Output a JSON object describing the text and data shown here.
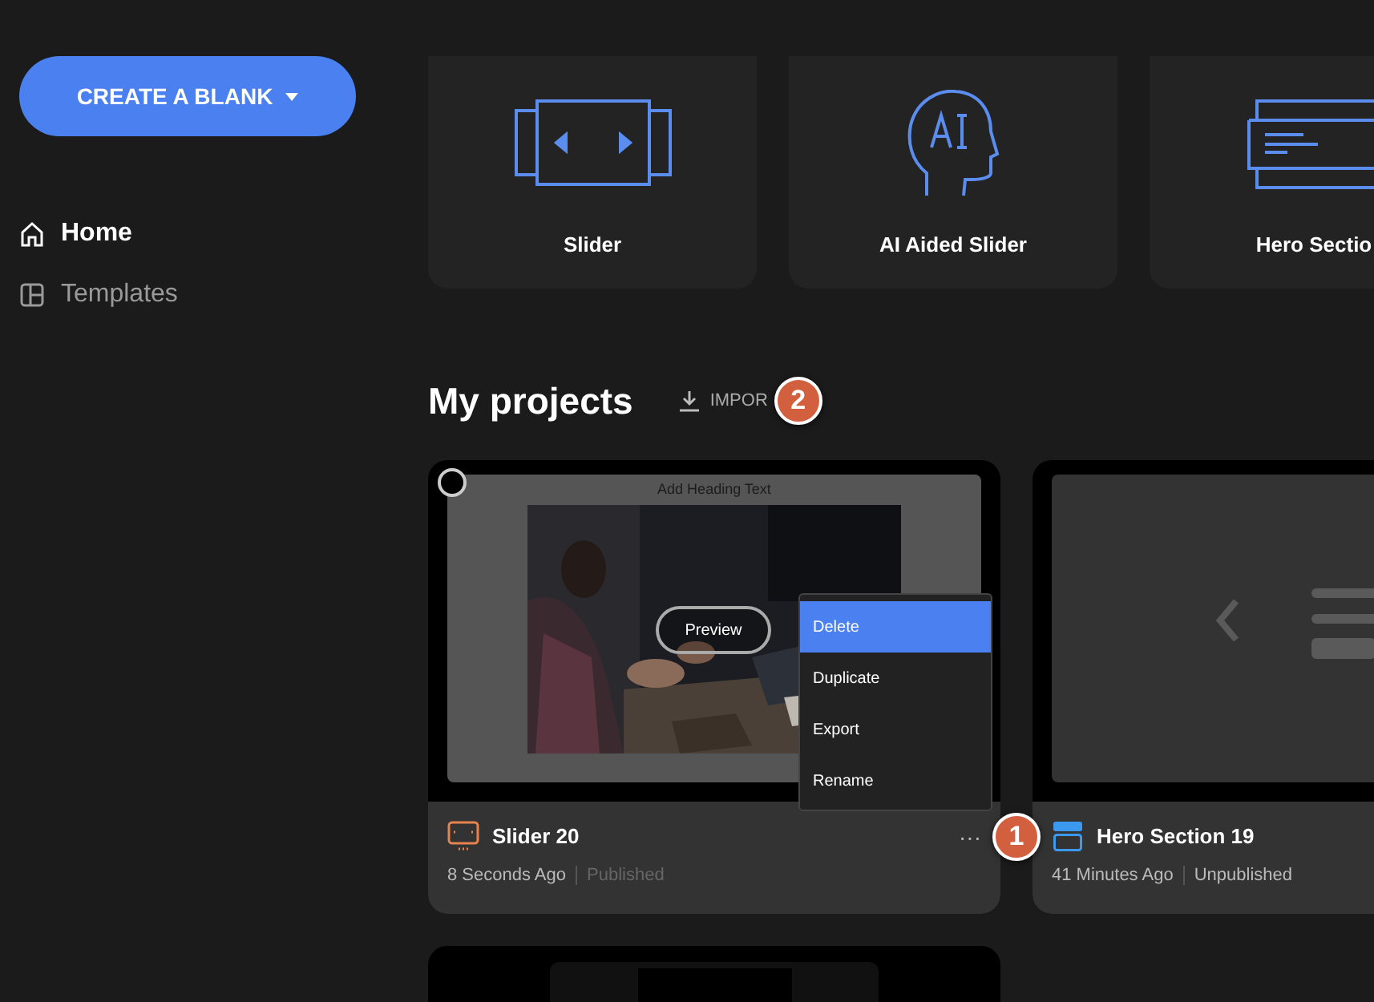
{
  "sidebar": {
    "create_button": {
      "label": "CREATE A BLANK"
    },
    "items": [
      {
        "label": "Home",
        "kind": "home",
        "selected": true
      },
      {
        "label": "Templates",
        "kind": "templates",
        "selected": false
      }
    ]
  },
  "templates": [
    {
      "label": "Slider",
      "kind": "slider"
    },
    {
      "label": "AI Aided Slider",
      "kind": "ai"
    },
    {
      "label": "Hero Sectio",
      "kind": "hero"
    }
  ],
  "projects_header": {
    "title": "My projects",
    "import_label": "IMPOR",
    "annotation": "2"
  },
  "projects": [
    {
      "kind": "slider",
      "name": "Slider 20",
      "time": "8 Seconds Ago",
      "status": "Published",
      "checkbox": {
        "checked": false
      },
      "preview": {
        "heading": "Add Heading Text",
        "button": "Preview"
      },
      "more": "···",
      "annotation": "1",
      "menu": [
        {
          "label": "Delete",
          "selected": true
        },
        {
          "label": "Duplicate",
          "selected": false
        },
        {
          "label": "Export",
          "selected": false
        },
        {
          "label": "Rename",
          "selected": false
        }
      ]
    },
    {
      "kind": "hero",
      "name": "Hero Section 19",
      "time": "41 Minutes Ago",
      "status": "Unpublished"
    },
    {
      "kind": "news"
    }
  ]
}
